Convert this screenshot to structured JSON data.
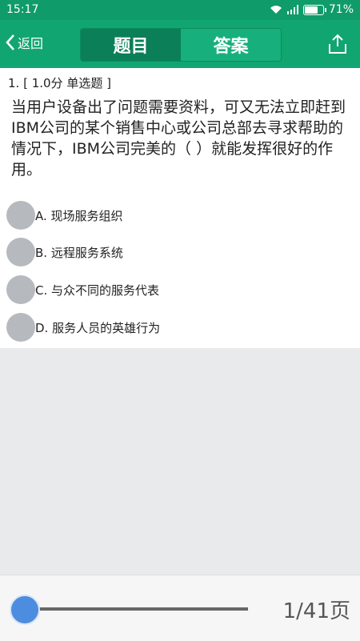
{
  "status": {
    "time": "15:17",
    "battery": "71%"
  },
  "header": {
    "back_label": "返回",
    "tab_question": "题目",
    "tab_answer": "答案"
  },
  "question": {
    "head": "1. [ 1.0分  单选题 ]",
    "text": "当用户设备出了问题需要资料，可又无法立即赶到IBM公司的某个销售中心或公司总部去寻求帮助的情况下，IBM公司完美的（  ）就能发挥很好的作用。",
    "options": [
      "A. 现场服务组织",
      "B. 远程服务系统",
      "C. 与众不同的服务代表",
      "D. 服务人员的英雄行为"
    ]
  },
  "footer": {
    "page": "1/41页",
    "progress": 0.02
  }
}
